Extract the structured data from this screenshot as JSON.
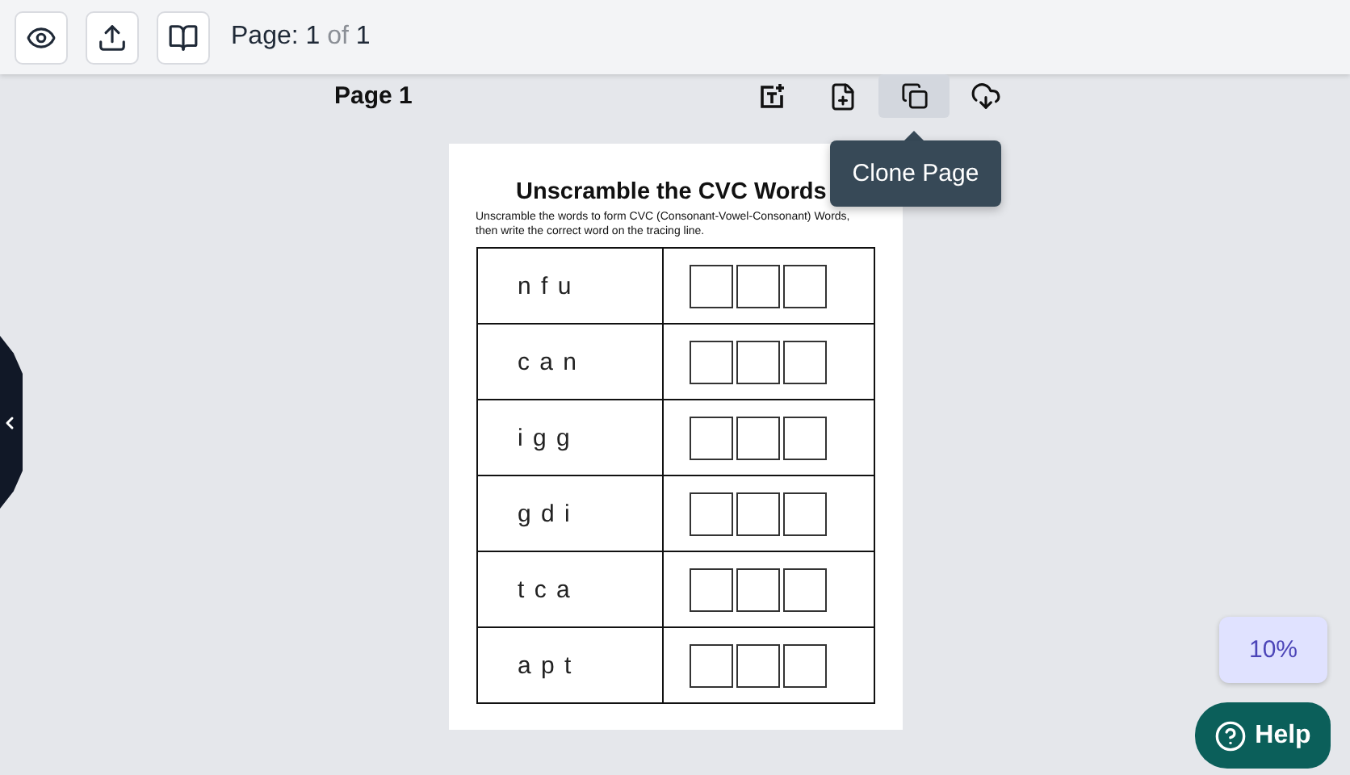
{
  "toolbar": {
    "buttons": [
      {
        "kind": "preview"
      },
      {
        "kind": "upload"
      },
      {
        "kind": "book"
      }
    ],
    "page_indicator": {
      "label": "Page:",
      "current": "1",
      "of": "of",
      "total": "1"
    }
  },
  "page_header": {
    "title": "Page 1",
    "actions": [
      {
        "kind": "add-text",
        "selected": false
      },
      {
        "kind": "add-page",
        "selected": false
      },
      {
        "kind": "clone",
        "selected": true
      },
      {
        "kind": "download",
        "selected": false
      }
    ],
    "tooltip": "Clone Page"
  },
  "worksheet": {
    "title": "Unscramble the CVC Words",
    "instructions": "Unscramble the words to form CVC (Consonant-Vowel-Consonant) Words, then write the correct word on the tracing line.",
    "rows": [
      {
        "letters": "n f u"
      },
      {
        "letters": "c a n"
      },
      {
        "letters": "i g g"
      },
      {
        "letters": "g d i"
      },
      {
        "letters": "t c a"
      },
      {
        "letters": "a p t"
      }
    ]
  },
  "zoom": "10%",
  "help": "Help"
}
